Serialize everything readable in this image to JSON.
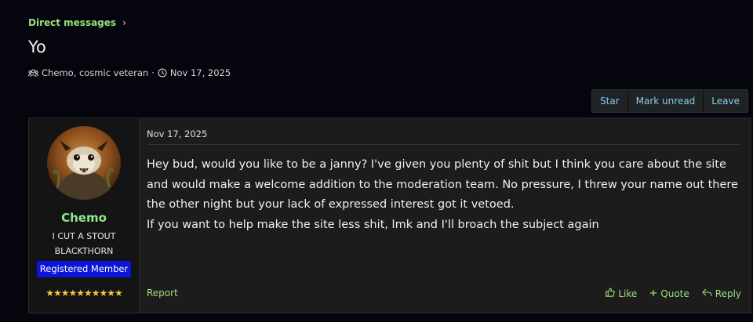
{
  "breadcrumb": {
    "label": "Direct messages"
  },
  "thread": {
    "title": "Yo",
    "participants": "Chemo, cosmic veteran",
    "separator": "·",
    "date": "Nov 17, 2025"
  },
  "actions": {
    "star": "Star",
    "mark_unread": "Mark unread",
    "leave": "Leave"
  },
  "post": {
    "author": {
      "name": "Chemo",
      "title_line1": "I CUT A STOUT",
      "title_line2": "BLACKTHORN",
      "role": "Registered Member",
      "stars": "★★★★★★★★★★"
    },
    "date": "Nov 17, 2025",
    "body": [
      "Hey bud, would you like to be a janny? I've given you plenty of shit but I think you care about the site and would make a welcome addition to the moderation team. No pressure, I threw your name out there the other night but your lack of expressed interest got it vetoed.",
      "If you want to help make the site less shit, lmk and I'll broach the subject again"
    ],
    "report": "Report",
    "like": "Like",
    "quote": "Quote",
    "reply": "Reply"
  },
  "colors": {
    "accent_green": "#9be07c",
    "username_green": "#8fe889",
    "link_blue": "#8ec9e6",
    "badge_blue": "#0b14d8",
    "star_gold": "#f6c842"
  },
  "icons": {
    "participants": "users-icon",
    "date": "clock-icon",
    "breadcrumb": "chevron-right-icon",
    "like": "thumbs-up-icon",
    "quote": "plus-icon",
    "reply": "reply-icon"
  }
}
